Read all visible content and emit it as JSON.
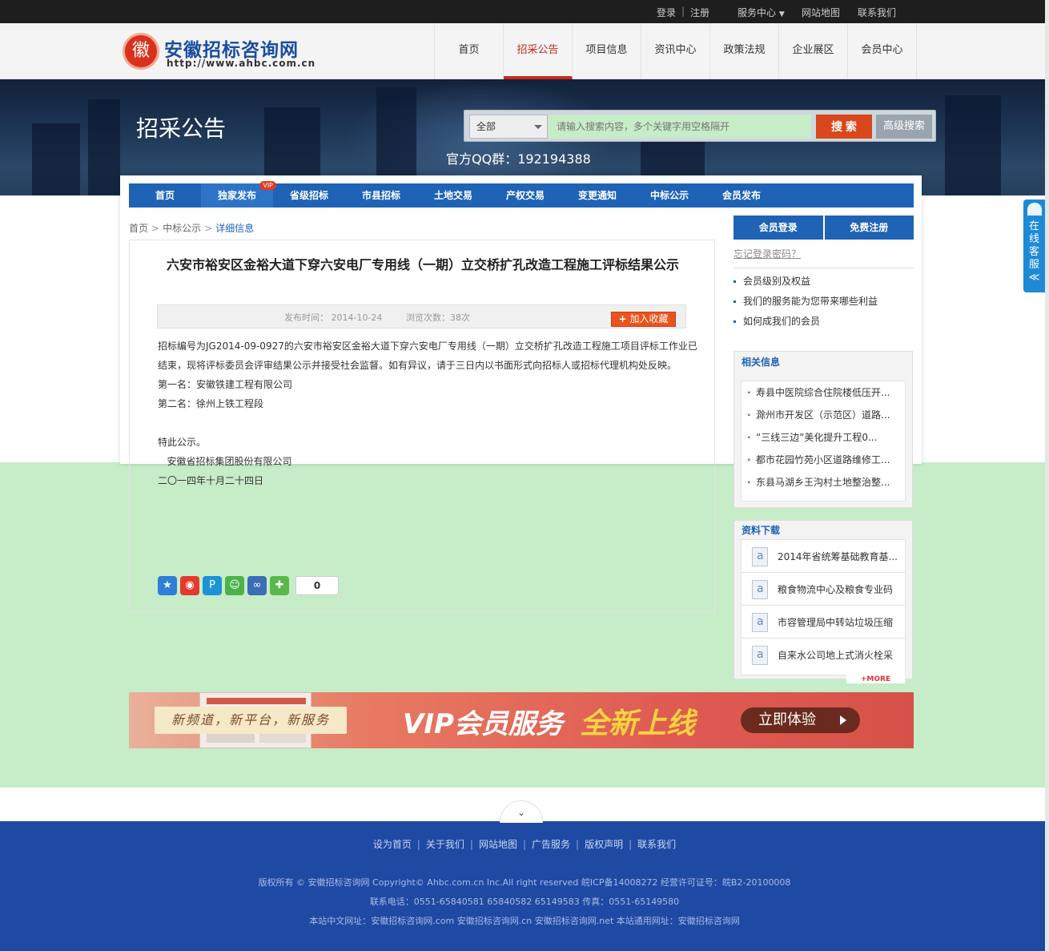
{
  "topbar": {
    "login": "登录",
    "divider": "|",
    "register": "注册",
    "service": "服务中心",
    "sitemap": "网站地图",
    "contact": "联系我们"
  },
  "logo": {
    "seal": "徽",
    "name": "安徽招标咨询网",
    "url": "http://www.ahbc.com.cn"
  },
  "mainnav": [
    "首页",
    "招采公告",
    "项目信息",
    "资讯中心",
    "政策法规",
    "企业展区",
    "会员中心"
  ],
  "banner": {
    "title": "招采公告",
    "qq": "官方QQ群：192194388"
  },
  "search": {
    "select": "全部",
    "placeholder": "请输入搜索内容，多个关键字用空格隔开",
    "button": "搜 索",
    "advanced": "高级搜索"
  },
  "subnav": [
    {
      "label": "首页"
    },
    {
      "label": "独家发布",
      "badge": "VIP"
    },
    {
      "label": "省级招标"
    },
    {
      "label": "市县招标"
    },
    {
      "label": "土地交易"
    },
    {
      "label": "产权交易"
    },
    {
      "label": "变更通知"
    },
    {
      "label": "中标公示"
    },
    {
      "label": "会员发布"
    }
  ],
  "breadcrumb": {
    "home": "首页",
    "sep": ">",
    "section": "中标公示",
    "current": "详细信息"
  },
  "article": {
    "title": "六安市裕安区金裕大道下穿六安电厂专用线（一期）立交桥扩孔改造工程施工评标结果公示",
    "published": "发布时间： 2014-10-24",
    "views": "浏览次数：38次",
    "favorite": "加入收藏",
    "paragraphs": [
      "招标编号为JG2014-09-0927的六安市裕安区金裕大道下穿六安电厂专用线（一期）立交桥扩孔改造工程施工项目评标工作业已",
      "结束，现将评标委员会评审结果公示并接受社会监督。如有异议，请于三日内以书面形式向招标人或招标代理机构处反映。",
      "第一名：安徽铁建工程有限公司",
      "第二名：徐州上铁工程段",
      "",
      "特此公示。",
      "   安徽省招标集团股份有限公司",
      "二〇一四年十月二十四日"
    ],
    "share_count": "0"
  },
  "member": {
    "login": "会员登录",
    "register": "免费注册",
    "forgot": "忘记登录密码？",
    "links": [
      "会员级别及权益",
      "我们的服务能为您带来哪些利益",
      "如何成我们的会员"
    ]
  },
  "related": {
    "title": "相关信息",
    "items": [
      "寿县中医院综合住院楼低压开...",
      "滁州市开发区（示范区）道路...",
      "“三线三边”美化提升工程0...",
      "都市花园竹苑小区道路维修工...",
      "东县马湖乡王沟村土地整治整..."
    ]
  },
  "downloads": {
    "title": "资料下载",
    "items": [
      "2014年省统筹基础教育基...",
      "粮食物流中心及粮食专业码",
      "市容管理局中转站垃圾压缩",
      "自来水公司地上式消火栓采"
    ],
    "more": "+MORE"
  },
  "vip_banner": {
    "slogan": "新频道，新平台，新服务",
    "t1": "VIP会员服务",
    "t2": "全新上线",
    "cta": "立即体验"
  },
  "footer": {
    "links": [
      "设为首页",
      "关于我们",
      "网站地图",
      "广告服务",
      "版权声明",
      "联系我们"
    ],
    "copyright": "版权所有 © 安徽招标咨询网 Copyright© Ahbc.com.cn Inc.All right reserved 皖ICP备14008272 经营许可证号：皖B2-20100008",
    "phone": "联系电话：0551-65840581 65840582 65149583 传真：0551-65149580",
    "domains": "本站中文网址：安徽招标咨询网.com 安徽招标咨询网.cn 安徽招标咨询网.net 本站通用网址：安徽招标咨询网"
  },
  "kefu": {
    "label": "在线客服",
    "arrow": "≪"
  },
  "colors": {
    "brand_blue": "#1e63b5",
    "accent_red": "#c62b1e",
    "footer_blue": "#1f4aa3"
  }
}
